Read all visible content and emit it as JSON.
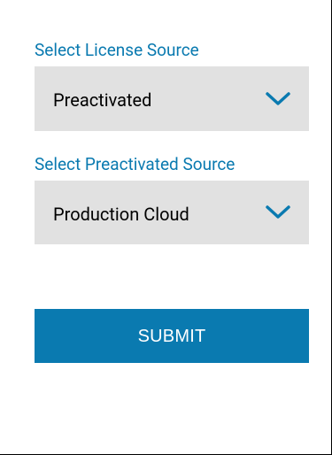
{
  "license_source": {
    "label": "Select License Source",
    "selected_value": "Preactivated",
    "icon": "chevron-down-icon"
  },
  "preactivated_source": {
    "label": "Select Preactivated Source",
    "selected_value": "Production Cloud",
    "icon": "chevron-down-icon"
  },
  "submit": {
    "label": "SUBMIT"
  },
  "colors": {
    "accent": "#0a7ab0",
    "select_background": "#e1e1e1",
    "text": "#000000",
    "button_text": "#ffffff"
  }
}
